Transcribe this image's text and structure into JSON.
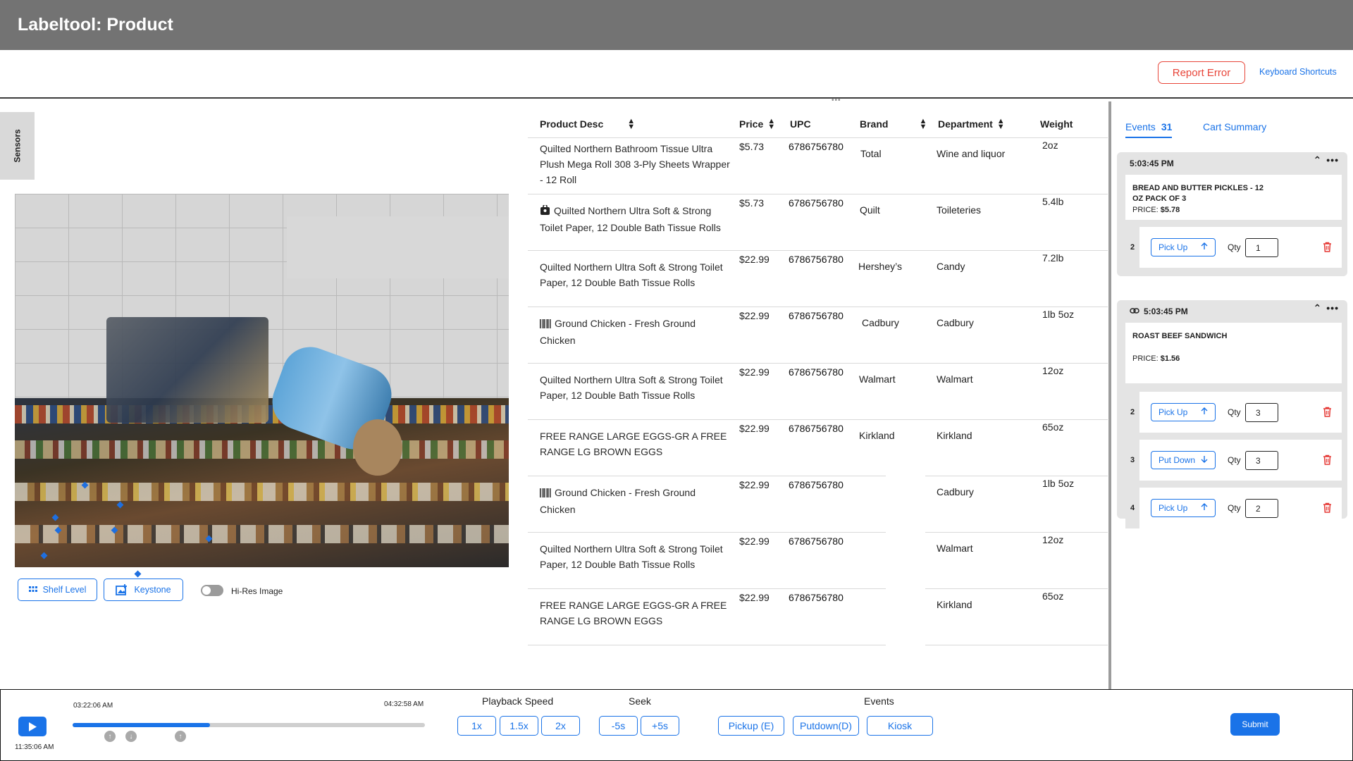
{
  "app": {
    "title": "Labeltool: Product"
  },
  "actions": {
    "report_error": "Report Error",
    "keyboard_shortcuts": "Keyboard Shortcuts"
  },
  "sidebar": {
    "sensors_label": "Sensors"
  },
  "image_toolbar": {
    "shelf_level": "Shelf Level",
    "keystone": "Keystone",
    "hires_label": "Hi-Res Image",
    "hires_on": false
  },
  "table": {
    "headers": {
      "desc": "Product Desc",
      "price": "Price",
      "upc": "UPC",
      "brand": "Brand",
      "department": "Department",
      "weight": "Weight"
    },
    "rows": [
      {
        "icon": "",
        "desc": "Quilted Northern Bathroom Tissue Ultra Plush Mega Roll 308 3-Ply Sheets Wrapper - 12 Roll",
        "price": "$5.73",
        "upc": "6786756780",
        "brand": "Total",
        "department": "Wine and liquor",
        "weight": "2oz"
      },
      {
        "icon": "bag-icon",
        "desc": "Quilted Northern Ultra Soft & Strong Toilet Paper, 12 Double Bath Tissue Rolls",
        "price": "$5.73",
        "upc": "6786756780",
        "brand": "Quilt",
        "department": "Toileteries",
        "weight": "5.4lb"
      },
      {
        "icon": "",
        "desc": "Quilted Northern Ultra Soft & Strong Toilet Paper, 12 Double Bath Tissue Rolls",
        "price": "$22.99",
        "upc": "6786756780",
        "brand": "Hershey’s",
        "department": "Candy",
        "weight": "7.2lb"
      },
      {
        "icon": "barcode-icon",
        "desc": "Ground Chicken - Fresh Ground Chicken",
        "price": "$22.99",
        "upc": "6786756780",
        "brand": "Cadbury",
        "department": "Cadbury",
        "weight": "1lb 5oz"
      },
      {
        "icon": "",
        "desc": "Quilted Northern Ultra Soft & Strong Toilet Paper, 12 Double Bath Tissue Rolls",
        "price": "$22.99",
        "upc": "6786756780",
        "brand": "Walmart",
        "department": "Walmart",
        "weight": "12oz"
      },
      {
        "icon": "",
        "desc": "FREE RANGE LARGE EGGS-GR A FREE RANGE LG BROWN EGGS",
        "price": "$22.99",
        "upc": "6786756780",
        "brand": "Kirkland",
        "department": "Kirkland",
        "weight": "65oz"
      },
      {
        "icon": "barcode-icon",
        "desc": "Ground Chicken - Fresh Ground Chicken",
        "price": "$22.99",
        "upc": "6786756780",
        "brand": "",
        "department": "Cadbury",
        "weight": "1lb 5oz"
      },
      {
        "icon": "",
        "desc": "Quilted Northern Ultra Soft & Strong Toilet Paper, 12 Double Bath Tissue Rolls",
        "price": "$22.99",
        "upc": "6786756780",
        "brand": "",
        "department": "Walmart",
        "weight": "12oz"
      },
      {
        "icon": "",
        "desc": "FREE RANGE LARGE EGGS-GR A FREE RANGE LG BROWN EGGS",
        "price": "$22.99",
        "upc": "6786756780",
        "brand": "",
        "department": "Kirkland",
        "weight": "65oz"
      }
    ]
  },
  "events_panel": {
    "tab_events": "Events",
    "events_count": "31",
    "tab_cart": "Cart Summary",
    "qty_label": "Qty",
    "cards": [
      {
        "time": "5:03:45 PM",
        "linked": false,
        "item_name": "BREAD AND BUTTER PICKLES - 12 OZ PACK OF 3",
        "price_label": "PRICE:",
        "price": "$5.78",
        "actions": [
          {
            "index": "2",
            "label": "Pick Up",
            "direction": "up",
            "qty": "1"
          }
        ]
      },
      {
        "time": "5:03:45 PM",
        "linked": true,
        "item_name": "ROAST BEEF SANDWICH",
        "price_label": "PRICE:",
        "price": "$1.56",
        "actions": [
          {
            "index": "2",
            "label": "Pick Up",
            "direction": "up",
            "qty": "3"
          },
          {
            "index": "3",
            "label": "Put Down",
            "direction": "down",
            "qty": "3"
          },
          {
            "index": "4",
            "label": "Pick Up",
            "direction": "up",
            "qty": "2"
          }
        ]
      }
    ]
  },
  "player": {
    "current_time": "11:35:06 AM",
    "start_time": "03:22:06 AM",
    "end_time": "04:32:58 AM",
    "progress_fraction": 0.39,
    "playback_speed_title": "Playback Speed",
    "speeds": [
      "1x",
      "1.5x",
      "2x"
    ],
    "seek_title": "Seek",
    "seek": [
      "-5s",
      "+5s"
    ],
    "events_title": "Events",
    "event_buttons": [
      "Pickup (E)",
      "Putdown(D)",
      "Kiosk"
    ],
    "submit": "Submit"
  }
}
